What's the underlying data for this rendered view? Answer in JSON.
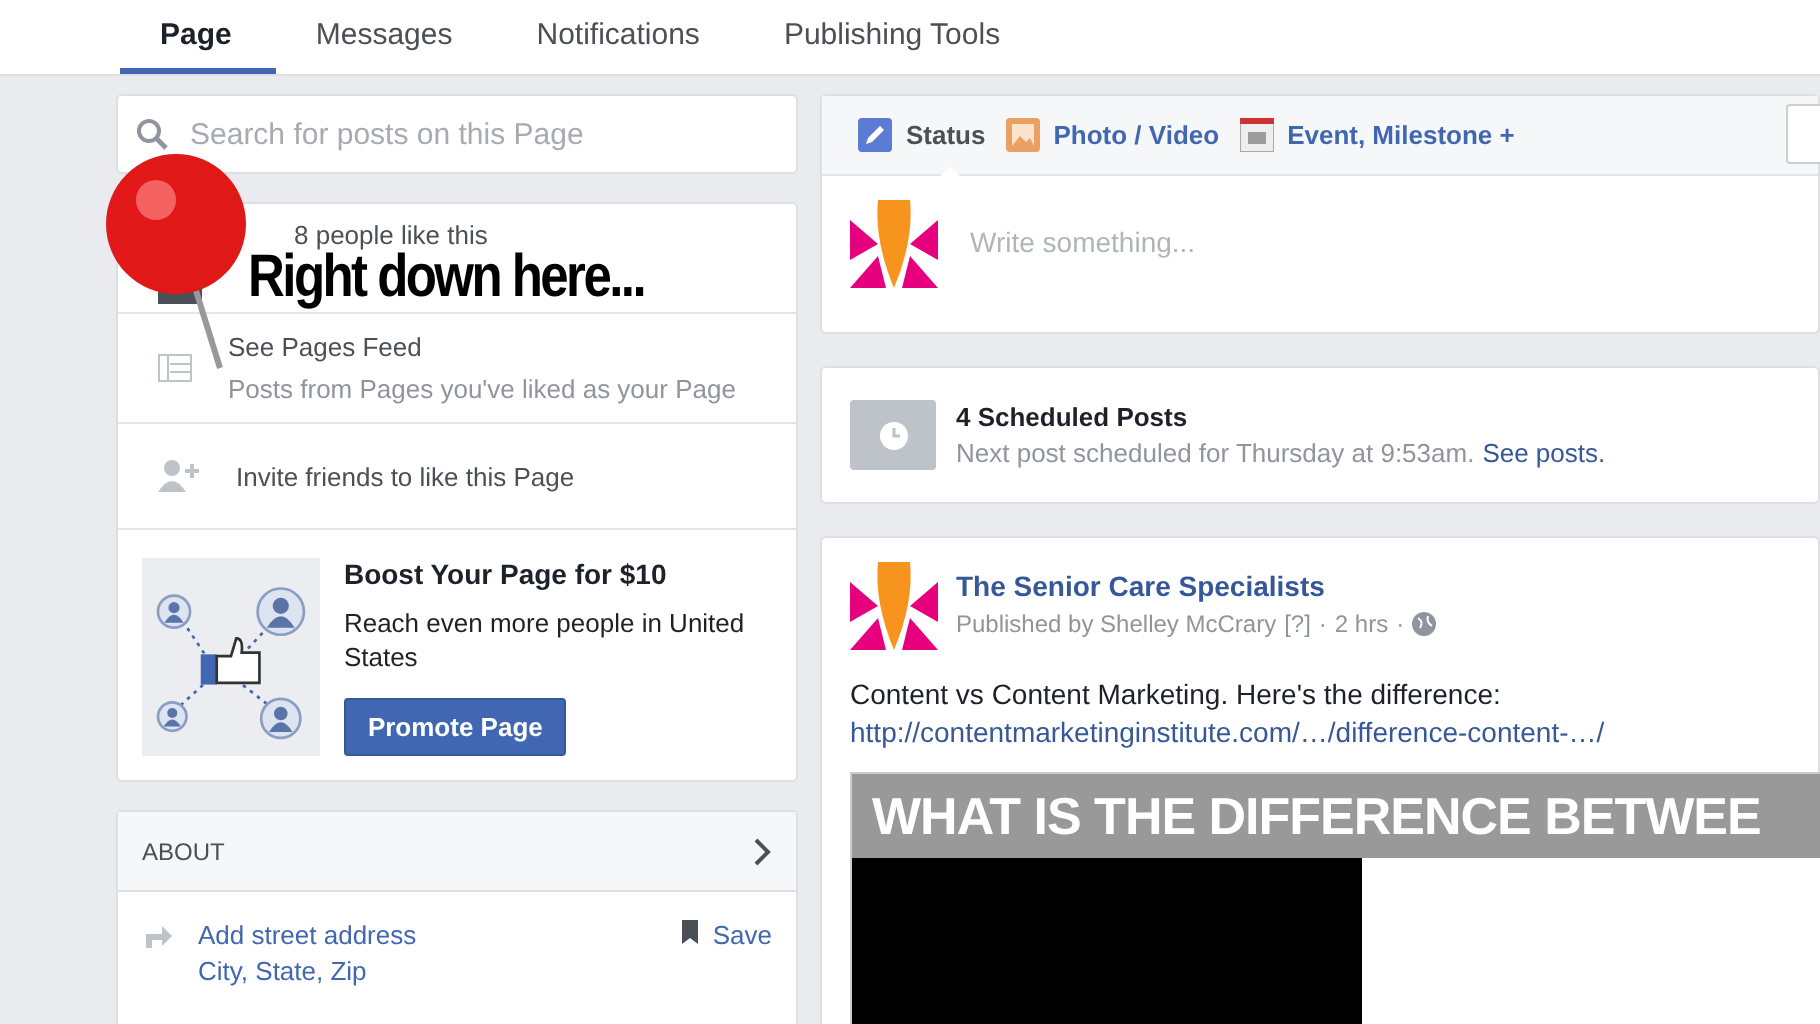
{
  "tabs": [
    {
      "label": "Page",
      "selected": true
    },
    {
      "label": "Messages",
      "selected": false
    },
    {
      "label": "Notifications",
      "selected": false
    },
    {
      "label": "Publishing Tools",
      "selected": false
    }
  ],
  "search": {
    "placeholder": "Search for posts on this Page"
  },
  "likes": {
    "text": "8 people like this"
  },
  "pages_feed": {
    "title": "See Pages Feed",
    "subtitle": "Posts from Pages you've liked as your Page"
  },
  "invite": {
    "text": "Invite friends to like this Page"
  },
  "boost": {
    "title": "Boost Your Page for $10",
    "body": "Reach even more people in United States",
    "button": "Promote Page"
  },
  "about": {
    "heading": "ABOUT",
    "address": "Add street address",
    "city": "City, State, Zip",
    "save": "Save"
  },
  "composer": {
    "tabs": [
      {
        "kind": "status",
        "label": "Status",
        "selected": true
      },
      {
        "kind": "photo",
        "label": "Photo / Video",
        "selected": false
      },
      {
        "kind": "event",
        "label": "Event, Milestone +",
        "selected": false
      }
    ],
    "placeholder": "Write something..."
  },
  "scheduled": {
    "title": "4 Scheduled Posts",
    "next": "Next post scheduled for Thursday at 9:53am.",
    "link": "See posts."
  },
  "post": {
    "page_name": "The Senior Care Specialists",
    "published_by": "Published by Shelley McCrary",
    "help": "[?]",
    "time": "2 hrs",
    "separator": "·",
    "text": "Content vs Content Marketing. Here's the difference:",
    "link": "http://contentmarketinginstitute.com/…/difference-content-…/",
    "image_headline": "WHAT IS THE DIFFERENCE BETWEE"
  },
  "annotation": {
    "text": "Right down here..."
  }
}
